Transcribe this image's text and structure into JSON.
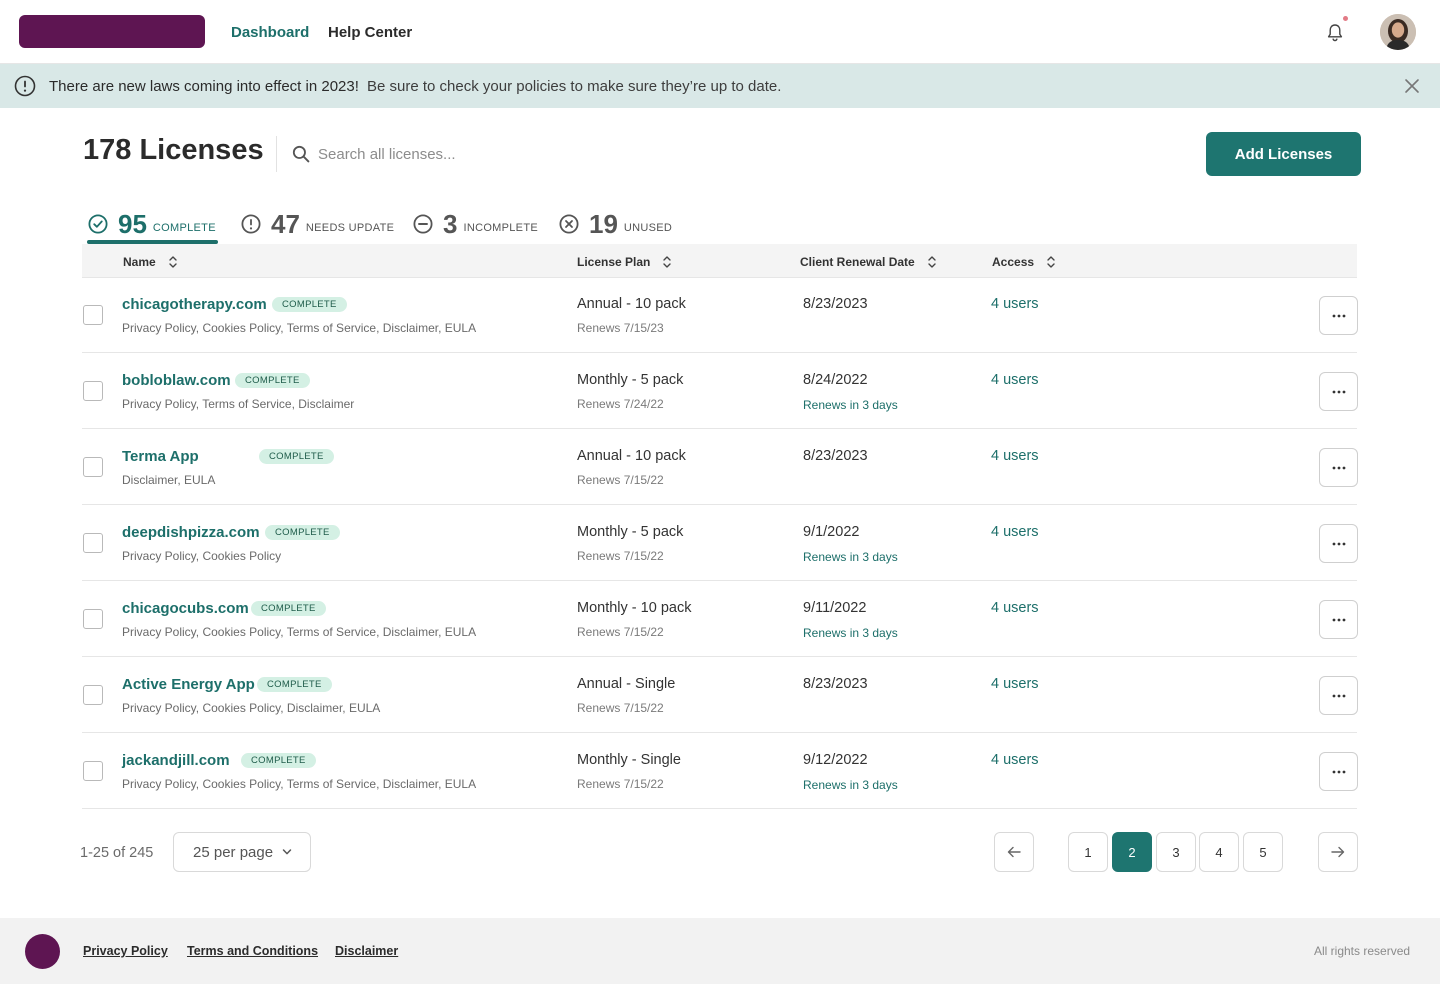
{
  "header": {
    "nav": [
      {
        "label": "Dashboard",
        "active": true
      },
      {
        "label": "Help Center",
        "active": false
      }
    ],
    "brand_color": "#5e1552",
    "accent_color": "#1d6f6a"
  },
  "banner": {
    "title": "There are new laws coming into effect in 2023!",
    "text": "Be sure to check your policies to make sure they’re up to date."
  },
  "page": {
    "title": "178 Licenses",
    "search_placeholder": "Search all licenses...",
    "add_label": "Add Licenses"
  },
  "stats": [
    {
      "count": "95",
      "label": "COMPLETE",
      "icon": "check-circle-icon"
    },
    {
      "count": "47",
      "label": "NEEDS UPDATE",
      "icon": "alert-circle-icon"
    },
    {
      "count": "3",
      "label": "INCOMPLETE",
      "icon": "minus-circle-icon"
    },
    {
      "count": "19",
      "label": "UNUSED",
      "icon": "x-circle-icon"
    }
  ],
  "table": {
    "columns": [
      "Name",
      "License Plan",
      "Client Renewal Date",
      "Access"
    ],
    "rows": [
      {
        "name": "chicagotherapy.com",
        "status": "COMPLETE",
        "policies": "Privacy Policy, Cookies Policy, Terms of Service, Disclaimer, EULA",
        "plan": "Annual - 10 pack",
        "renews": "Renews 7/15/23",
        "date": "8/23/2023",
        "date_note": "",
        "access": "4 users"
      },
      {
        "name": "bobloblaw.com",
        "status": "COMPLETE",
        "policies": "Privacy Policy, Terms of Service, Disclaimer",
        "plan": "Monthly - 5 pack",
        "renews": "Renews 7/24/22",
        "date": "8/24/2022",
        "date_note": "Renews in 3 days",
        "access": "4 users"
      },
      {
        "name": "Terma App",
        "status": "COMPLETE",
        "policies": "Disclaimer, EULA",
        "plan": "Annual - 10 pack",
        "renews": "Renews 7/15/22",
        "date": "8/23/2023",
        "date_note": "",
        "access": "4 users"
      },
      {
        "name": "deepdishpizza.com",
        "status": "COMPLETE",
        "policies": "Privacy Policy, Cookies Policy",
        "plan": "Monthly - 5 pack",
        "renews": "Renews 7/15/22",
        "date": "9/1/2022",
        "date_note": "Renews in 3 days",
        "access": "4 users"
      },
      {
        "name": "chicagocubs.com",
        "status": "COMPLETE",
        "policies": "Privacy Policy, Cookies Policy, Terms of Service, Disclaimer, EULA",
        "plan": "Monthly - 10 pack",
        "renews": "Renews 7/15/22",
        "date": "9/11/2022",
        "date_note": "Renews in 3 days",
        "access": "4 users"
      },
      {
        "name": "Active Energy App",
        "status": "COMPLETE",
        "policies": "Privacy Policy, Cookies Policy, Disclaimer, EULA",
        "plan": "Annual - Single",
        "renews": "Renews 7/15/22",
        "date": "8/23/2023",
        "date_note": "",
        "access": "4 users"
      },
      {
        "name": "jackandjill.com",
        "status": "COMPLETE",
        "policies": "Privacy Policy, Cookies Policy, Terms of Service, Disclaimer, EULA",
        "plan": "Monthly - Single",
        "renews": "Renews 7/15/22",
        "date": "9/12/2022",
        "date_note": "Renews in 3 days",
        "access": "4 users"
      }
    ]
  },
  "pagination": {
    "range": "1-25 of 245",
    "per_page": "25 per page",
    "pages": [
      "1",
      "2",
      "3",
      "4",
      "5"
    ],
    "current": "2"
  },
  "footer": {
    "links": [
      "Privacy Policy",
      "Terms and Conditions",
      "Disclaimer"
    ],
    "rights": "All rights reserved"
  }
}
